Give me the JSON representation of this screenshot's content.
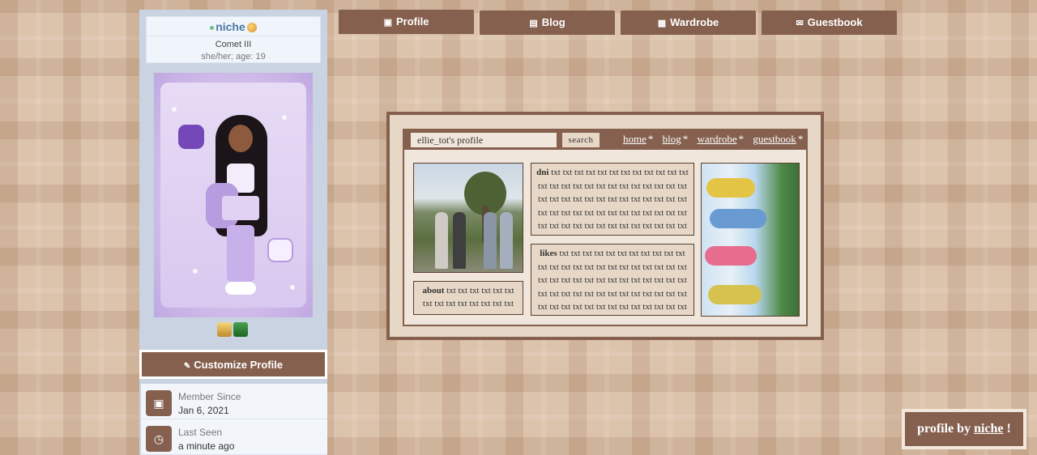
{
  "sidebar": {
    "username": "niche",
    "title": "Comet III",
    "pronouns": "she/her; age: 19",
    "customize_label": "Customize Profile",
    "info": [
      {
        "label": "Member Since",
        "value": "Jan 6, 2021",
        "icon": "calendar-icon"
      },
      {
        "label": "Last Seen",
        "value": "a minute ago",
        "icon": "calendar-clock-icon"
      }
    ]
  },
  "tabs": [
    {
      "label": "Profile",
      "icon": "id-card-icon"
    },
    {
      "label": "Blog",
      "icon": "newspaper-icon"
    },
    {
      "label": "Wardrobe",
      "icon": "grid-icon"
    },
    {
      "label": "Guestbook",
      "icon": "message-icon"
    }
  ],
  "widget": {
    "search_value": "ellie_tot's profile",
    "search_button": "search",
    "nav": [
      "home",
      "blog",
      "wardrobe",
      "guestbook"
    ],
    "nav_suffix": "*",
    "about_title": "about",
    "about_text": "txt txt txt txt txt txt txt txt txt txt txt txt txt txt",
    "dni_title": "dni",
    "dni_text": "txt txt txt txt txt txt txt txt txt txt txt txt txt txt txt txt txt txt txt txt txt txt txt txt txt txt txt txt txt txt txt txt txt txt txt txt txt txt txt txt txt txt txt txt txt txt txt txt txt txt txt txt txt txt txt txt txt txt txt txt txt txt txt txt",
    "likes_title": "likes",
    "likes_text": "txt txt txt txt txt txt txt txt txt txt txt txt txt txt txt txt txt txt txt txt txt txt txt txt txt txt txt txt txt txt txt txt txt txt txt txt txt txt txt txt txt txt txt txt txt txt txt txt txt txt txt txt txt txt txt txt txt txt txt txt txt txt txt"
  },
  "credit": {
    "prefix": "profile by",
    "link": "niche",
    "suffix": "!"
  },
  "colors": {
    "accent": "#85604e",
    "background": "#dcc3ab",
    "sidebar": "#c9d3e1"
  }
}
